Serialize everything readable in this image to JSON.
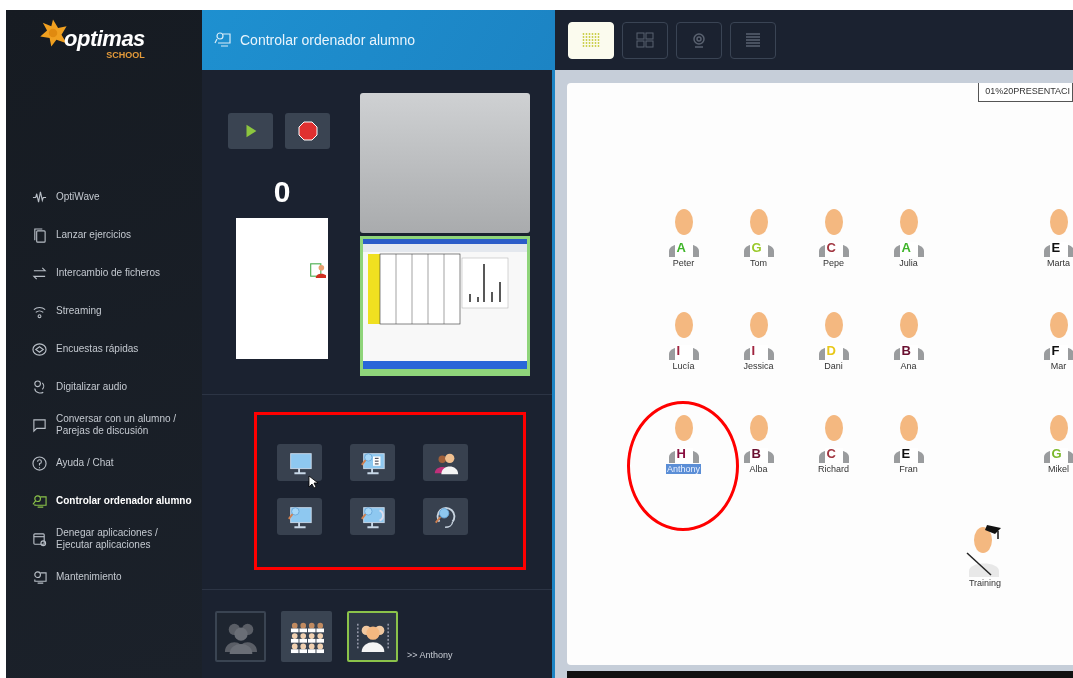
{
  "logo": {
    "name": "optimas",
    "subtitle": "SCHOOL"
  },
  "sidebar": {
    "items": [
      {
        "label": "OptiWave",
        "selected": false
      },
      {
        "label": "Lanzar ejercicios",
        "selected": false
      },
      {
        "label": "Intercambio de ficheros",
        "selected": false
      },
      {
        "label": "Streaming",
        "selected": false
      },
      {
        "label": "Encuestas rápidas",
        "selected": false
      },
      {
        "label": "Digitalizar audio",
        "selected": false
      },
      {
        "label": "Conversar con un alumno / Parejas de discusión",
        "selected": false
      },
      {
        "label": "Ayuda / Chat",
        "selected": false
      },
      {
        "label": "Controlar ordenador alumno",
        "selected": true
      },
      {
        "label": "Denegar aplicaciones / Ejecutar aplicaciones",
        "selected": false
      },
      {
        "label": "Mantenimiento",
        "selected": false
      }
    ]
  },
  "panel": {
    "title": "Controlar ordenador alumno",
    "counter": "0",
    "view_buttons": [
      {
        "selected": false
      },
      {
        "selected": false
      },
      {
        "selected": true
      }
    ],
    "target": ">> Anthony"
  },
  "toolbar": {
    "views": [
      {
        "selected": true
      },
      {
        "selected": false
      },
      {
        "selected": false
      },
      {
        "selected": false
      }
    ]
  },
  "file_field": {
    "value": "01%20PRESENTACI"
  },
  "classroom": {
    "rows": [
      [
        {
          "kind": "student",
          "name": "Peter",
          "letter": "A",
          "color": "#3fb52a",
          "selected": false
        },
        {
          "kind": "student",
          "name": "Tom",
          "letter": "G",
          "color": "#9ac92a",
          "selected": false
        },
        {
          "kind": "student",
          "name": "Pepe",
          "letter": "C",
          "color": "#a0343f",
          "selected": false
        },
        {
          "kind": "student",
          "name": "Julia",
          "letter": "A",
          "color": "#3fb52a",
          "selected": false
        },
        {
          "kind": "empty"
        },
        {
          "kind": "student",
          "name": "Marta",
          "letter": "E",
          "color": "#111111",
          "selected": false
        }
      ],
      [
        {
          "kind": "student",
          "name": "Lucía",
          "letter": "I",
          "color": "#a0243f",
          "selected": false
        },
        {
          "kind": "student",
          "name": "Jessica",
          "letter": "I",
          "color": "#a0243f",
          "selected": false
        },
        {
          "kind": "student",
          "name": "Dani",
          "letter": "D",
          "color": "#e8c81a",
          "selected": false
        },
        {
          "kind": "student",
          "name": "Ana",
          "letter": "B",
          "color": "#6a1030",
          "selected": false
        },
        {
          "kind": "empty"
        },
        {
          "kind": "student",
          "name": "Mar",
          "letter": "F",
          "color": "#111111",
          "selected": false
        }
      ],
      [
        {
          "kind": "student",
          "name": "Anthony",
          "letter": "H",
          "color": "#8a1040",
          "selected": true
        },
        {
          "kind": "student",
          "name": "Alba",
          "letter": "B",
          "color": "#6a1030",
          "selected": false
        },
        {
          "kind": "student",
          "name": "Richard",
          "letter": "C",
          "color": "#a0343f",
          "selected": false
        },
        {
          "kind": "student",
          "name": "Fran",
          "letter": "E",
          "color": "#111111",
          "selected": false
        },
        {
          "kind": "empty"
        },
        {
          "kind": "student",
          "name": "Mikel",
          "letter": "G",
          "color": "#7ab82a",
          "selected": false
        }
      ]
    ],
    "teacher": {
      "name": "Training"
    }
  }
}
